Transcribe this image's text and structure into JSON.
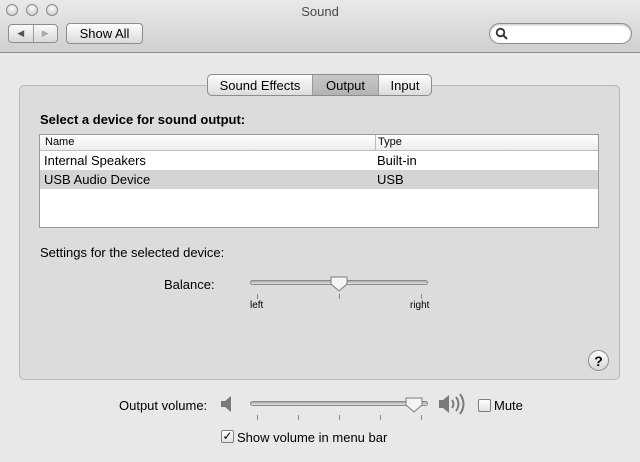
{
  "window": {
    "title": "Sound"
  },
  "toolbar": {
    "show_all_label": "Show All",
    "search": {
      "value": "",
      "icon": "magnifier-icon"
    }
  },
  "tabs": [
    {
      "label": "Sound Effects",
      "active": false
    },
    {
      "label": "Output",
      "active": true
    },
    {
      "label": "Input",
      "active": false
    }
  ],
  "output": {
    "heading": "Select a device for sound output:",
    "columns": [
      "Name",
      "Type"
    ],
    "devices": [
      {
        "name": "Internal Speakers",
        "type": "Built-in",
        "selected": false
      },
      {
        "name": "USB Audio Device",
        "type": "USB",
        "selected": true
      }
    ],
    "settings_heading": "Settings for the selected device:",
    "balance": {
      "label": "Balance:",
      "left_label": "left",
      "right_label": "right",
      "value": 0.5
    }
  },
  "footer": {
    "output_volume": {
      "label": "Output volume:",
      "value": 0.97
    },
    "mute": {
      "label": "Mute",
      "checked": false
    },
    "show_in_menu_bar": {
      "label": "Show volume in menu bar",
      "checked": true
    },
    "help": "?"
  },
  "colors": {
    "panel": "#dcdcdc",
    "selected_row": "#d4d4d4",
    "window_bg": "#e8e8e8"
  }
}
